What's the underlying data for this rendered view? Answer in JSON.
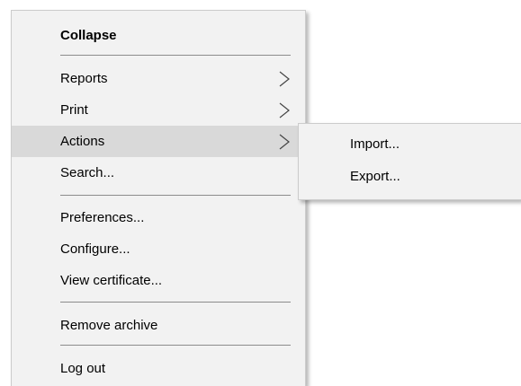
{
  "menu": {
    "items": [
      {
        "label": "Collapse"
      },
      {
        "label": "Reports"
      },
      {
        "label": "Print"
      },
      {
        "label": "Actions"
      },
      {
        "label": "Search..."
      },
      {
        "label": "Preferences..."
      },
      {
        "label": "Configure..."
      },
      {
        "label": "View certificate..."
      },
      {
        "label": "Remove archive"
      },
      {
        "label": "Log out"
      }
    ],
    "highlighted": "Actions"
  },
  "submenu": {
    "items": [
      {
        "label": "Import..."
      },
      {
        "label": "Export..."
      }
    ]
  },
  "icons": {
    "submenu_arrow": "chevron-right-icon"
  },
  "colors": {
    "menu_bg": "#f2f2f2",
    "highlight_bg": "#d9d9d9",
    "separator": "#8c8c8c"
  }
}
